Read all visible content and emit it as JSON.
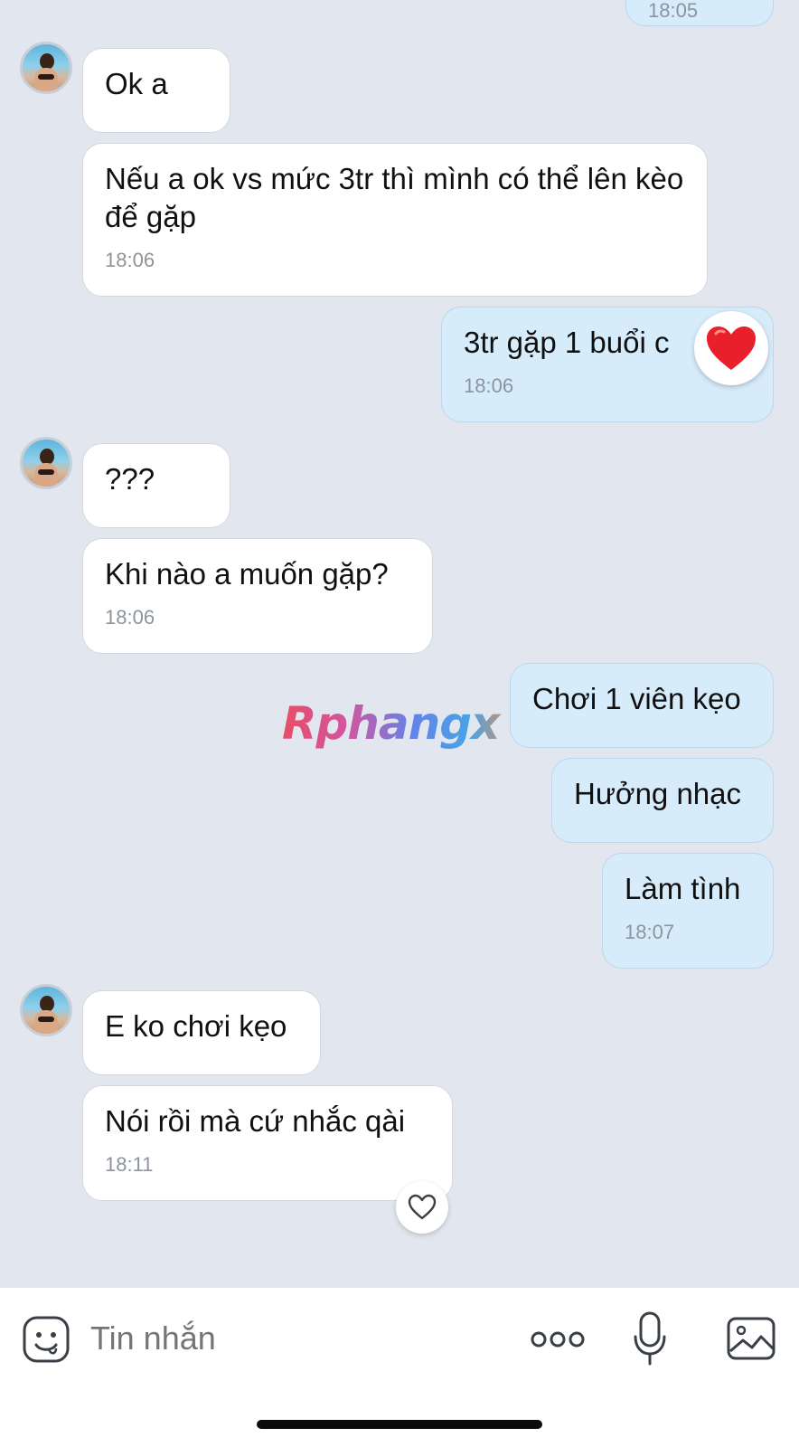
{
  "messages": {
    "m0_time": "18:05",
    "m1_text": "Ok a",
    "m2_text": "Nếu a ok vs mức 3tr thì mình có thể lên kèo để gặp",
    "m2_time": "18:06",
    "m3_text": "3tr gặp 1 buổi c",
    "m3_time": "18:06",
    "m3_reaction": "heart",
    "m4_text": "???",
    "m5_text": "Khi nào a muốn gặp?",
    "m5_time": "18:06",
    "m6_text": "Chơi 1 viên kẹo",
    "m7_text": "Hưởng nhạc",
    "m8_text": "Làm tình",
    "m8_time": "18:07",
    "m9_text": "E ko chơi kẹo",
    "m10_text": "Nói rồi mà cứ nhắc qài",
    "m10_time": "18:11"
  },
  "watermark": "Rphangx",
  "composer": {
    "placeholder": "Tin nhắn",
    "icons": [
      "sticker-icon",
      "more-icon",
      "microphone-icon",
      "image-icon"
    ]
  },
  "colors": {
    "background": "#e2e6ee",
    "incoming_bubble": "#ffffff",
    "outgoing_bubble": "#d7ecfb",
    "timestamp": "#8e949c",
    "heart": "#e8202c"
  }
}
